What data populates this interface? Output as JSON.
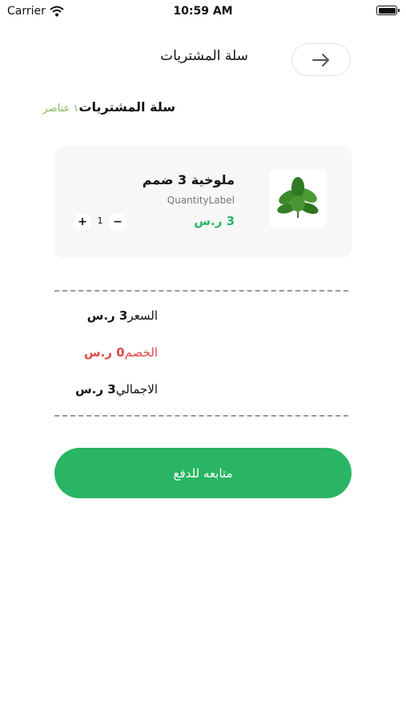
{
  "status_bar": {
    "carrier": "Carrier",
    "time": "10:59 AM"
  },
  "header": {
    "title": "سلة المشتريات",
    "back_icon": "arrow-right-icon"
  },
  "section": {
    "title": "سلة المشتريات",
    "count_label": "١ عناصر"
  },
  "cart_items": [
    {
      "name": "ملوخية 3 ضمم",
      "quantity_label": "QuantityLabel",
      "price": "3 ر.س",
      "quantity": "1",
      "plus_label": "+",
      "minus_label": "−"
    }
  ],
  "summary": {
    "subtotal_label": "السعر",
    "subtotal_value": "3 ر.س",
    "discount_label": "الخصم",
    "discount_value": "0 ر.س",
    "total_label": "الاجمالي",
    "total_value": "3 ر.س"
  },
  "checkout_button": {
    "label": "متابعه للدفع"
  },
  "colors": {
    "accent": "#2ab564",
    "discount": "#e34747",
    "count": "#7dbf5e"
  }
}
